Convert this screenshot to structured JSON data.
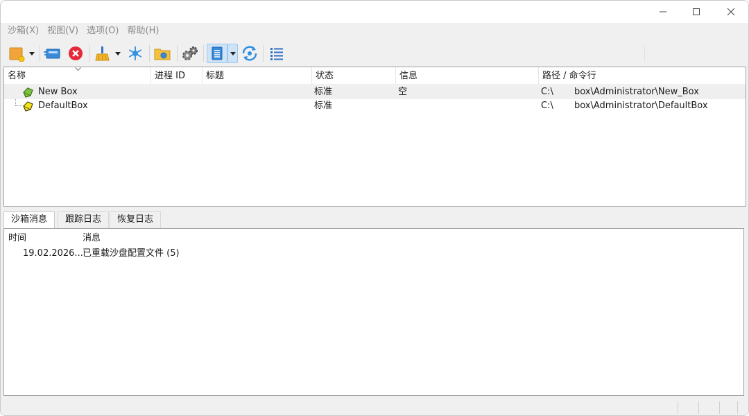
{
  "menu": {
    "items": [
      "沙箱(X)",
      "视图(V)",
      "选项(O)",
      "帮助(H)"
    ]
  },
  "colors": {
    "accent_pressed": "#cfe3f7",
    "selected_row": "#efefef",
    "box_icon_green": "#7cc242",
    "box_icon_yellow": "#f5e21b"
  },
  "toolbar": {
    "icons": [
      "new-box-icon",
      "run-icon",
      "terminate-all-icon",
      "clean-up-icon",
      "freeze-icon",
      "explore-icon",
      "settings-icon",
      "view-mode-icon",
      "refresh-icon",
      "list-view-icon"
    ]
  },
  "boxlist": {
    "columns": {
      "name": "名称",
      "pid": "进程 ID",
      "title": "标题",
      "status": "状态",
      "info": "信息",
      "path": "路径 / 命令行"
    },
    "rows": [
      {
        "name": "New Box",
        "status": "标准",
        "info": "空",
        "path_drive": "C:\\",
        "path_rest": "box\\Administrator\\New_Box",
        "icon": "box-green-icon"
      },
      {
        "name": "DefaultBox",
        "status": "标准",
        "info": "",
        "path_drive": "C:\\",
        "path_rest": "box\\Administrator\\DefaultBox",
        "icon": "box-yellow-icon"
      }
    ]
  },
  "tabs": {
    "items": [
      "沙箱消息",
      "跟踪日志",
      "恢复日志"
    ],
    "active_index": 0
  },
  "log": {
    "columns": {
      "time": "时间",
      "message": "消息"
    },
    "rows": [
      {
        "time": "19.02.2026...",
        "message": "已重载沙盘配置文件 (5)"
      }
    ]
  }
}
